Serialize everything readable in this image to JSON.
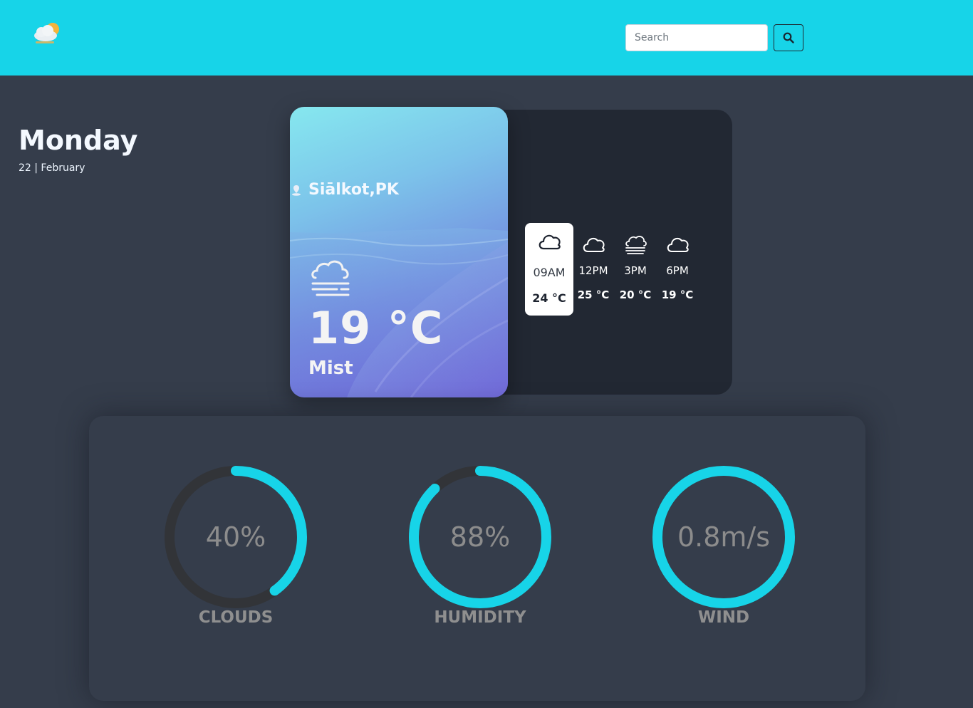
{
  "header": {
    "search_placeholder": "Search",
    "accent_color": "#17d4e8"
  },
  "today": {
    "day": "Monday",
    "date": "22 | February",
    "location": "Siālkot,PK",
    "temperature": "19 °C",
    "condition": "Mist",
    "icon": "mist-icon"
  },
  "hourly": [
    {
      "time": "09AM",
      "temp": "24 °C",
      "icon": "cloud-icon",
      "active": true
    },
    {
      "time": "12PM",
      "temp": "25 °C",
      "icon": "cloud-icon",
      "active": false
    },
    {
      "time": "3PM",
      "temp": "20 °C",
      "icon": "mist-icon",
      "active": false
    },
    {
      "time": "6PM",
      "temp": "19 °C",
      "icon": "cloud-icon",
      "active": false
    }
  ],
  "stats": [
    {
      "label": "CLOUDS",
      "value": "40%",
      "fraction": 0.4
    },
    {
      "label": "HUMIDITY",
      "value": "88%",
      "fraction": 0.88
    },
    {
      "label": "WIND",
      "value": "0.8m/s",
      "fraction": 1.0
    }
  ]
}
